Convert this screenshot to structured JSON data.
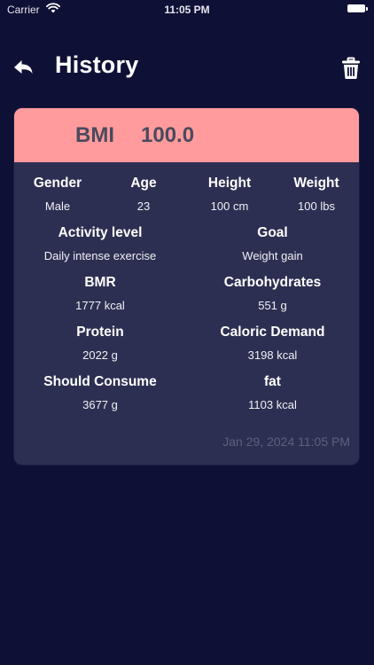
{
  "status_bar": {
    "carrier": "Carrier",
    "time": "11:05 PM"
  },
  "header": {
    "title": "History"
  },
  "record": {
    "bmi_label": "BMI",
    "bmi_value": "100.0",
    "gender": {
      "label": "Gender",
      "value": "Male"
    },
    "age": {
      "label": "Age",
      "value": "23"
    },
    "height": {
      "label": "Height",
      "value": "100 cm"
    },
    "weight": {
      "label": "Weight",
      "value": "100 lbs"
    },
    "activity": {
      "label": "Activity level",
      "value": "Daily intense exercise"
    },
    "goal": {
      "label": "Goal",
      "value": "Weight gain"
    },
    "bmr": {
      "label": "BMR",
      "value": "1777 kcal"
    },
    "carbs": {
      "label": "Carbohydrates",
      "value": "551 g"
    },
    "protein": {
      "label": "Protein",
      "value": "2022 g"
    },
    "caloric": {
      "label": "Caloric Demand",
      "value": "3198 kcal"
    },
    "should": {
      "label": "Should Consume",
      "value": "3677 g"
    },
    "fat": {
      "label": "fat",
      "value": "1103 kcal"
    },
    "timestamp": "Jan 29, 2024 11:05 PM"
  },
  "icons": {
    "back": "back-arrow-icon",
    "trash": "trash-icon",
    "wifi": "wifi-icon",
    "battery": "battery-icon"
  },
  "colors": {
    "background": "#0e1035",
    "card": "#2d2f52",
    "card_header": "#ff9b9c"
  }
}
